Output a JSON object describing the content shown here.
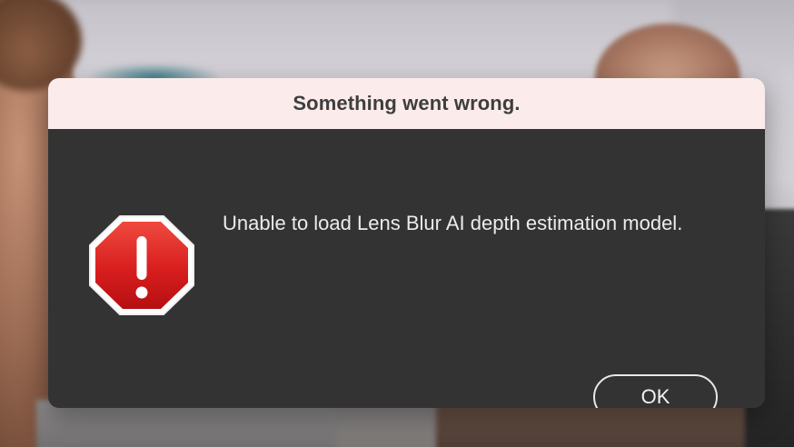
{
  "dialog": {
    "title": "Something went wrong.",
    "message": "Unable to load Lens Blur AI depth estimation model.",
    "icon": "alert-octagon-icon",
    "ok_label": "OK"
  },
  "colors": {
    "titlebar_bg": "#fbeceb",
    "dialog_bg": "#333333",
    "alert_red": "#d81e1e",
    "text_light": "#ececec",
    "title_text": "#3e3e3e"
  }
}
